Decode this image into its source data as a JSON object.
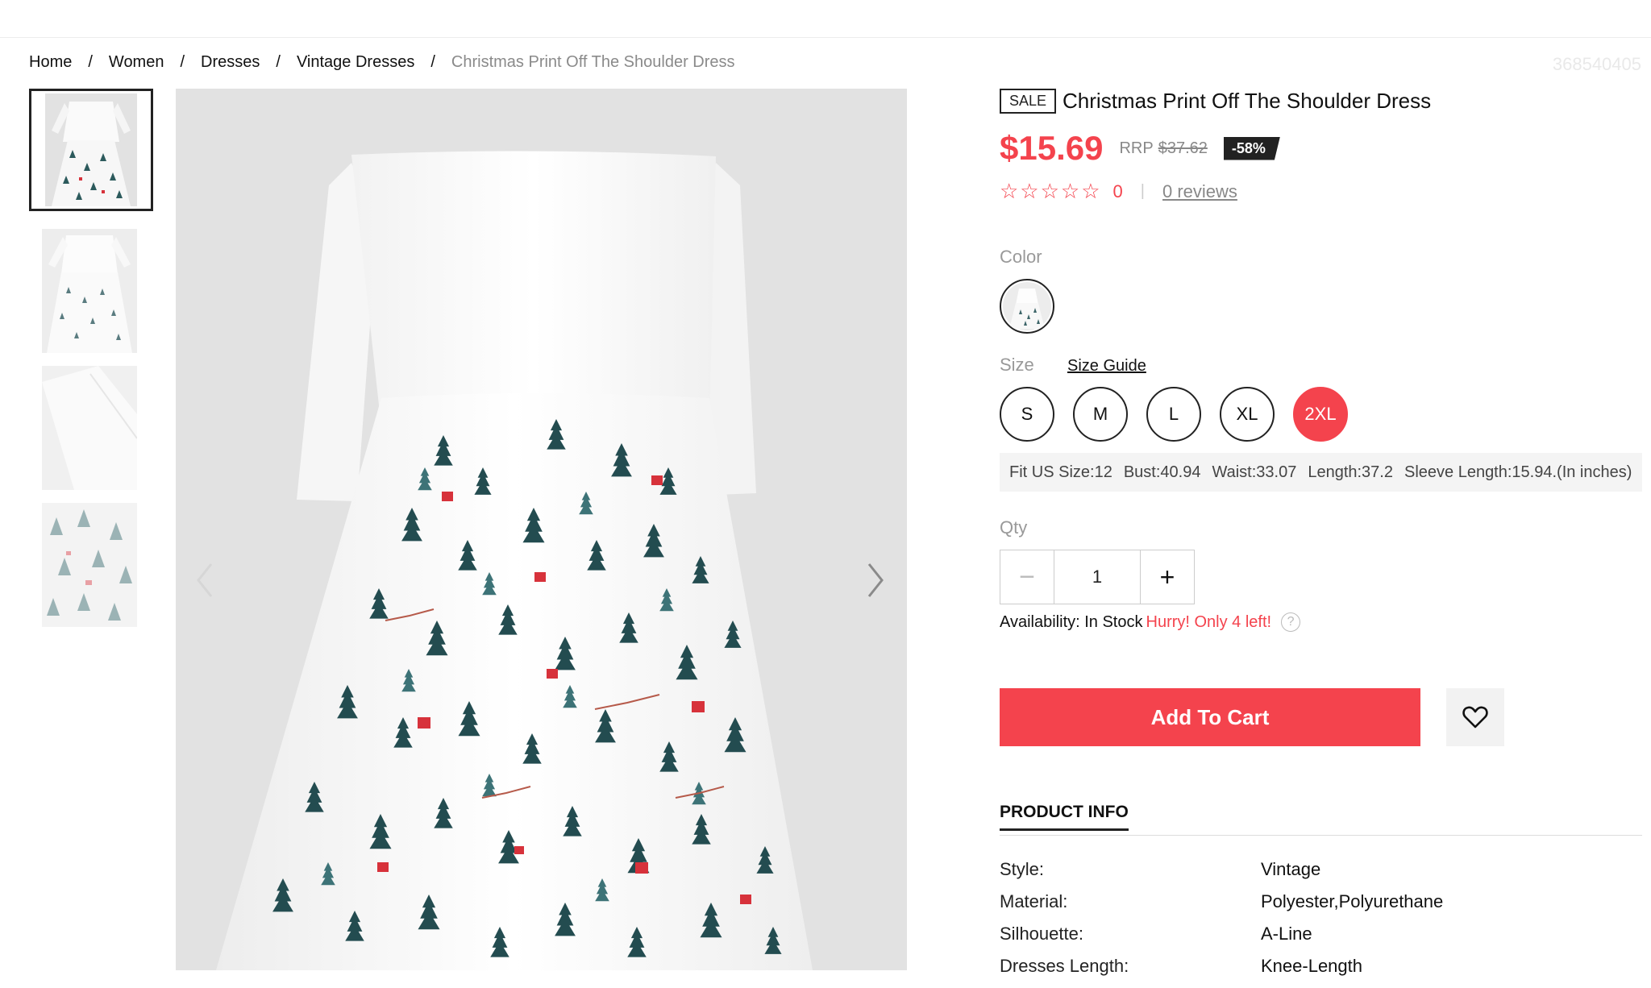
{
  "breadcrumb": {
    "items": [
      "Home",
      "Women",
      "Dresses",
      "Vintage Dresses"
    ],
    "separator": "/",
    "current": "Christmas Print Off The Shoulder Dress"
  },
  "sku": "368540405",
  "product": {
    "sale_badge": "SALE",
    "title": "Christmas Print Off The Shoulder Dress",
    "price": "$15.69",
    "rrp_label": "RRP",
    "rrp_value": "$37.62",
    "discount": "-58%",
    "stars": "☆☆☆☆☆",
    "rating_count": "0",
    "rating_divider": "|",
    "reviews_link": "0 reviews"
  },
  "color": {
    "label": "Color"
  },
  "size": {
    "label": "Size",
    "guide_link": "Size Guide",
    "options": [
      "S",
      "M",
      "L",
      "XL",
      "2XL"
    ],
    "selected": "2XL",
    "fit": {
      "fit_us": "Fit US Size:12",
      "bust": "Bust:40.94",
      "waist": "Waist:33.07",
      "length": "Length:37.2",
      "sleeve": "Sleeve Length:15.94.(In inches)"
    }
  },
  "qty": {
    "label": "Qty",
    "minus": "−",
    "value": "1",
    "plus": "+"
  },
  "availability": {
    "label": "Availability: In Stock",
    "hurry": "Hurry! Only 4 left!",
    "help": "?"
  },
  "actions": {
    "add_to_cart": "Add To Cart"
  },
  "info_tab": "PRODUCT INFO",
  "specs": [
    {
      "k": "Style:",
      "v": "Vintage"
    },
    {
      "k": "Material:",
      "v": "Polyester,Polyurethane"
    },
    {
      "k": "Silhouette:",
      "v": "A-Line"
    },
    {
      "k": "Dresses Length:",
      "v": "Knee-Length"
    }
  ],
  "colors": {
    "accent": "#f4434d",
    "dark": "#222222",
    "muted": "#999999"
  },
  "icons": {
    "prev": "chevron-left-icon",
    "next": "chevron-right-icon",
    "wishlist": "heart-icon",
    "help": "question-circle-icon"
  }
}
